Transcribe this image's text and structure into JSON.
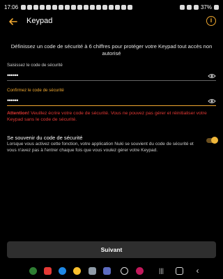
{
  "statusbar": {
    "time": "17:06",
    "battery": "37%"
  },
  "appbar": {
    "title": "Keypad",
    "back_icon": "arrow-left-icon",
    "info_icon": "info-icon"
  },
  "intro": "Définissez un code de sécurité à 6 chiffres pour protéger votre Keypad tout accès non autorisé",
  "field_code": {
    "label": "Saisissez le code de sécurité",
    "value": "••••••"
  },
  "field_confirm": {
    "label": "Confirmez le code de sécurité",
    "value": "••••••"
  },
  "attention": {
    "prefix": "Attention!",
    "text": " Veuillez écrire votre code de sécurité. Vous ne pouvez pas gérer et réinitialiser votre Keypad sans le code de sécurité."
  },
  "remember": {
    "title": "Se souvenir du code de sécurité",
    "description": "Lorsque vous activez cette fonction, votre application Nuki se souvient du code de sécurité et vous n'avez pas à l'entrer chaque fois que vous voulez gérer votre Keypad.",
    "enabled": true
  },
  "next_button": "Suivant",
  "colors": {
    "accent": "#f0a830",
    "warning": "#e53935",
    "background": "#000000",
    "button": "#2e2e2e"
  }
}
